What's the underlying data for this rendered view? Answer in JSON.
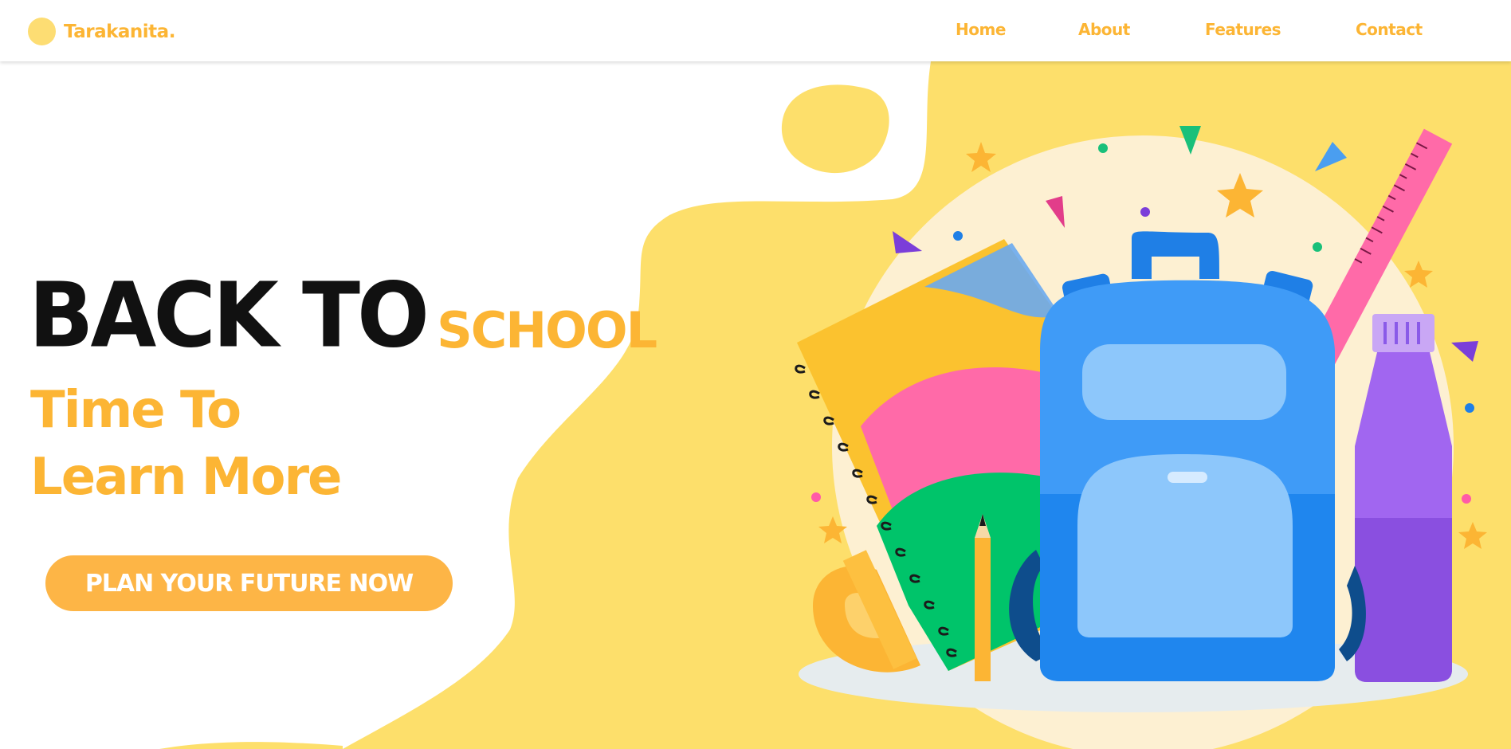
{
  "brand": {
    "name": "Tarakanita."
  },
  "nav": {
    "items": [
      "Home",
      "About",
      "Features",
      "Contact"
    ]
  },
  "hero": {
    "line1_main": "BACK TO",
    "line1_accent": "SCHOOL",
    "line2": "Time To",
    "line3": "Learn More",
    "cta_label": "PLAN YOUR FUTURE NOW"
  },
  "colors": {
    "accent": "#fcb534",
    "background_blob": "#fddf6b",
    "button": "#fdb546",
    "heading_dark": "#111111"
  }
}
